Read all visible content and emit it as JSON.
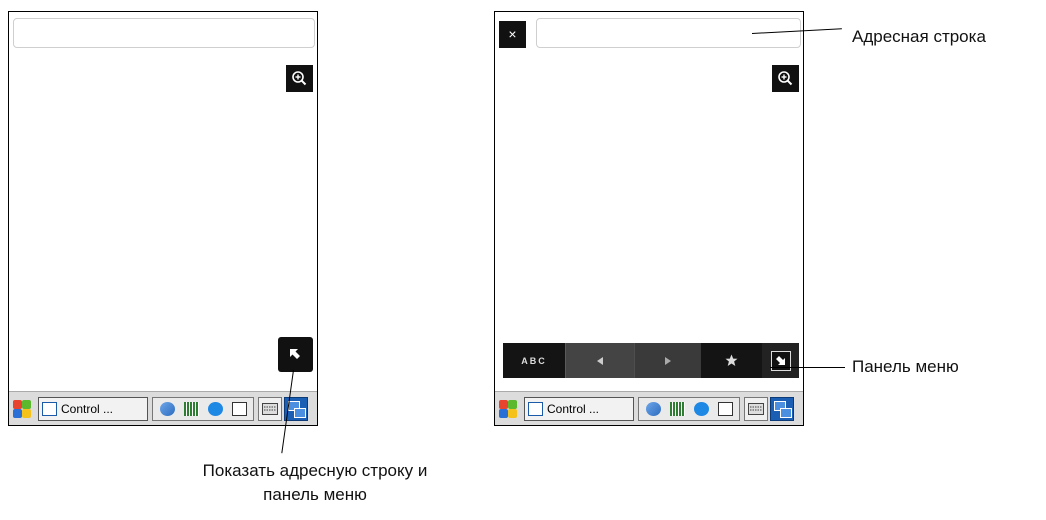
{
  "screens": {
    "left": {
      "taskbar": {
        "task_label": "Control ..."
      }
    },
    "right": {
      "close_label": "×",
      "menu": {
        "abc_label": "ABC"
      },
      "taskbar": {
        "task_label": "Control ..."
      }
    }
  },
  "icons": {
    "zoom": "zoom-in-icon",
    "show_bar": "arrow-up-left-icon",
    "back": "triangle-left-icon",
    "forward": "triangle-right-icon",
    "favorites": "star-icon",
    "hide_bar": "arrow-down-right-icon"
  },
  "callouts": {
    "address_bar": "Адресная строка",
    "menu_bar": "Панель меню",
    "show_bars": "Показать адресную строку и панель меню"
  },
  "colors": {
    "button_bg": "#111111",
    "menu_bar_bg": "#1a1a1a",
    "taskbar_bg": "#dcdcdc"
  }
}
